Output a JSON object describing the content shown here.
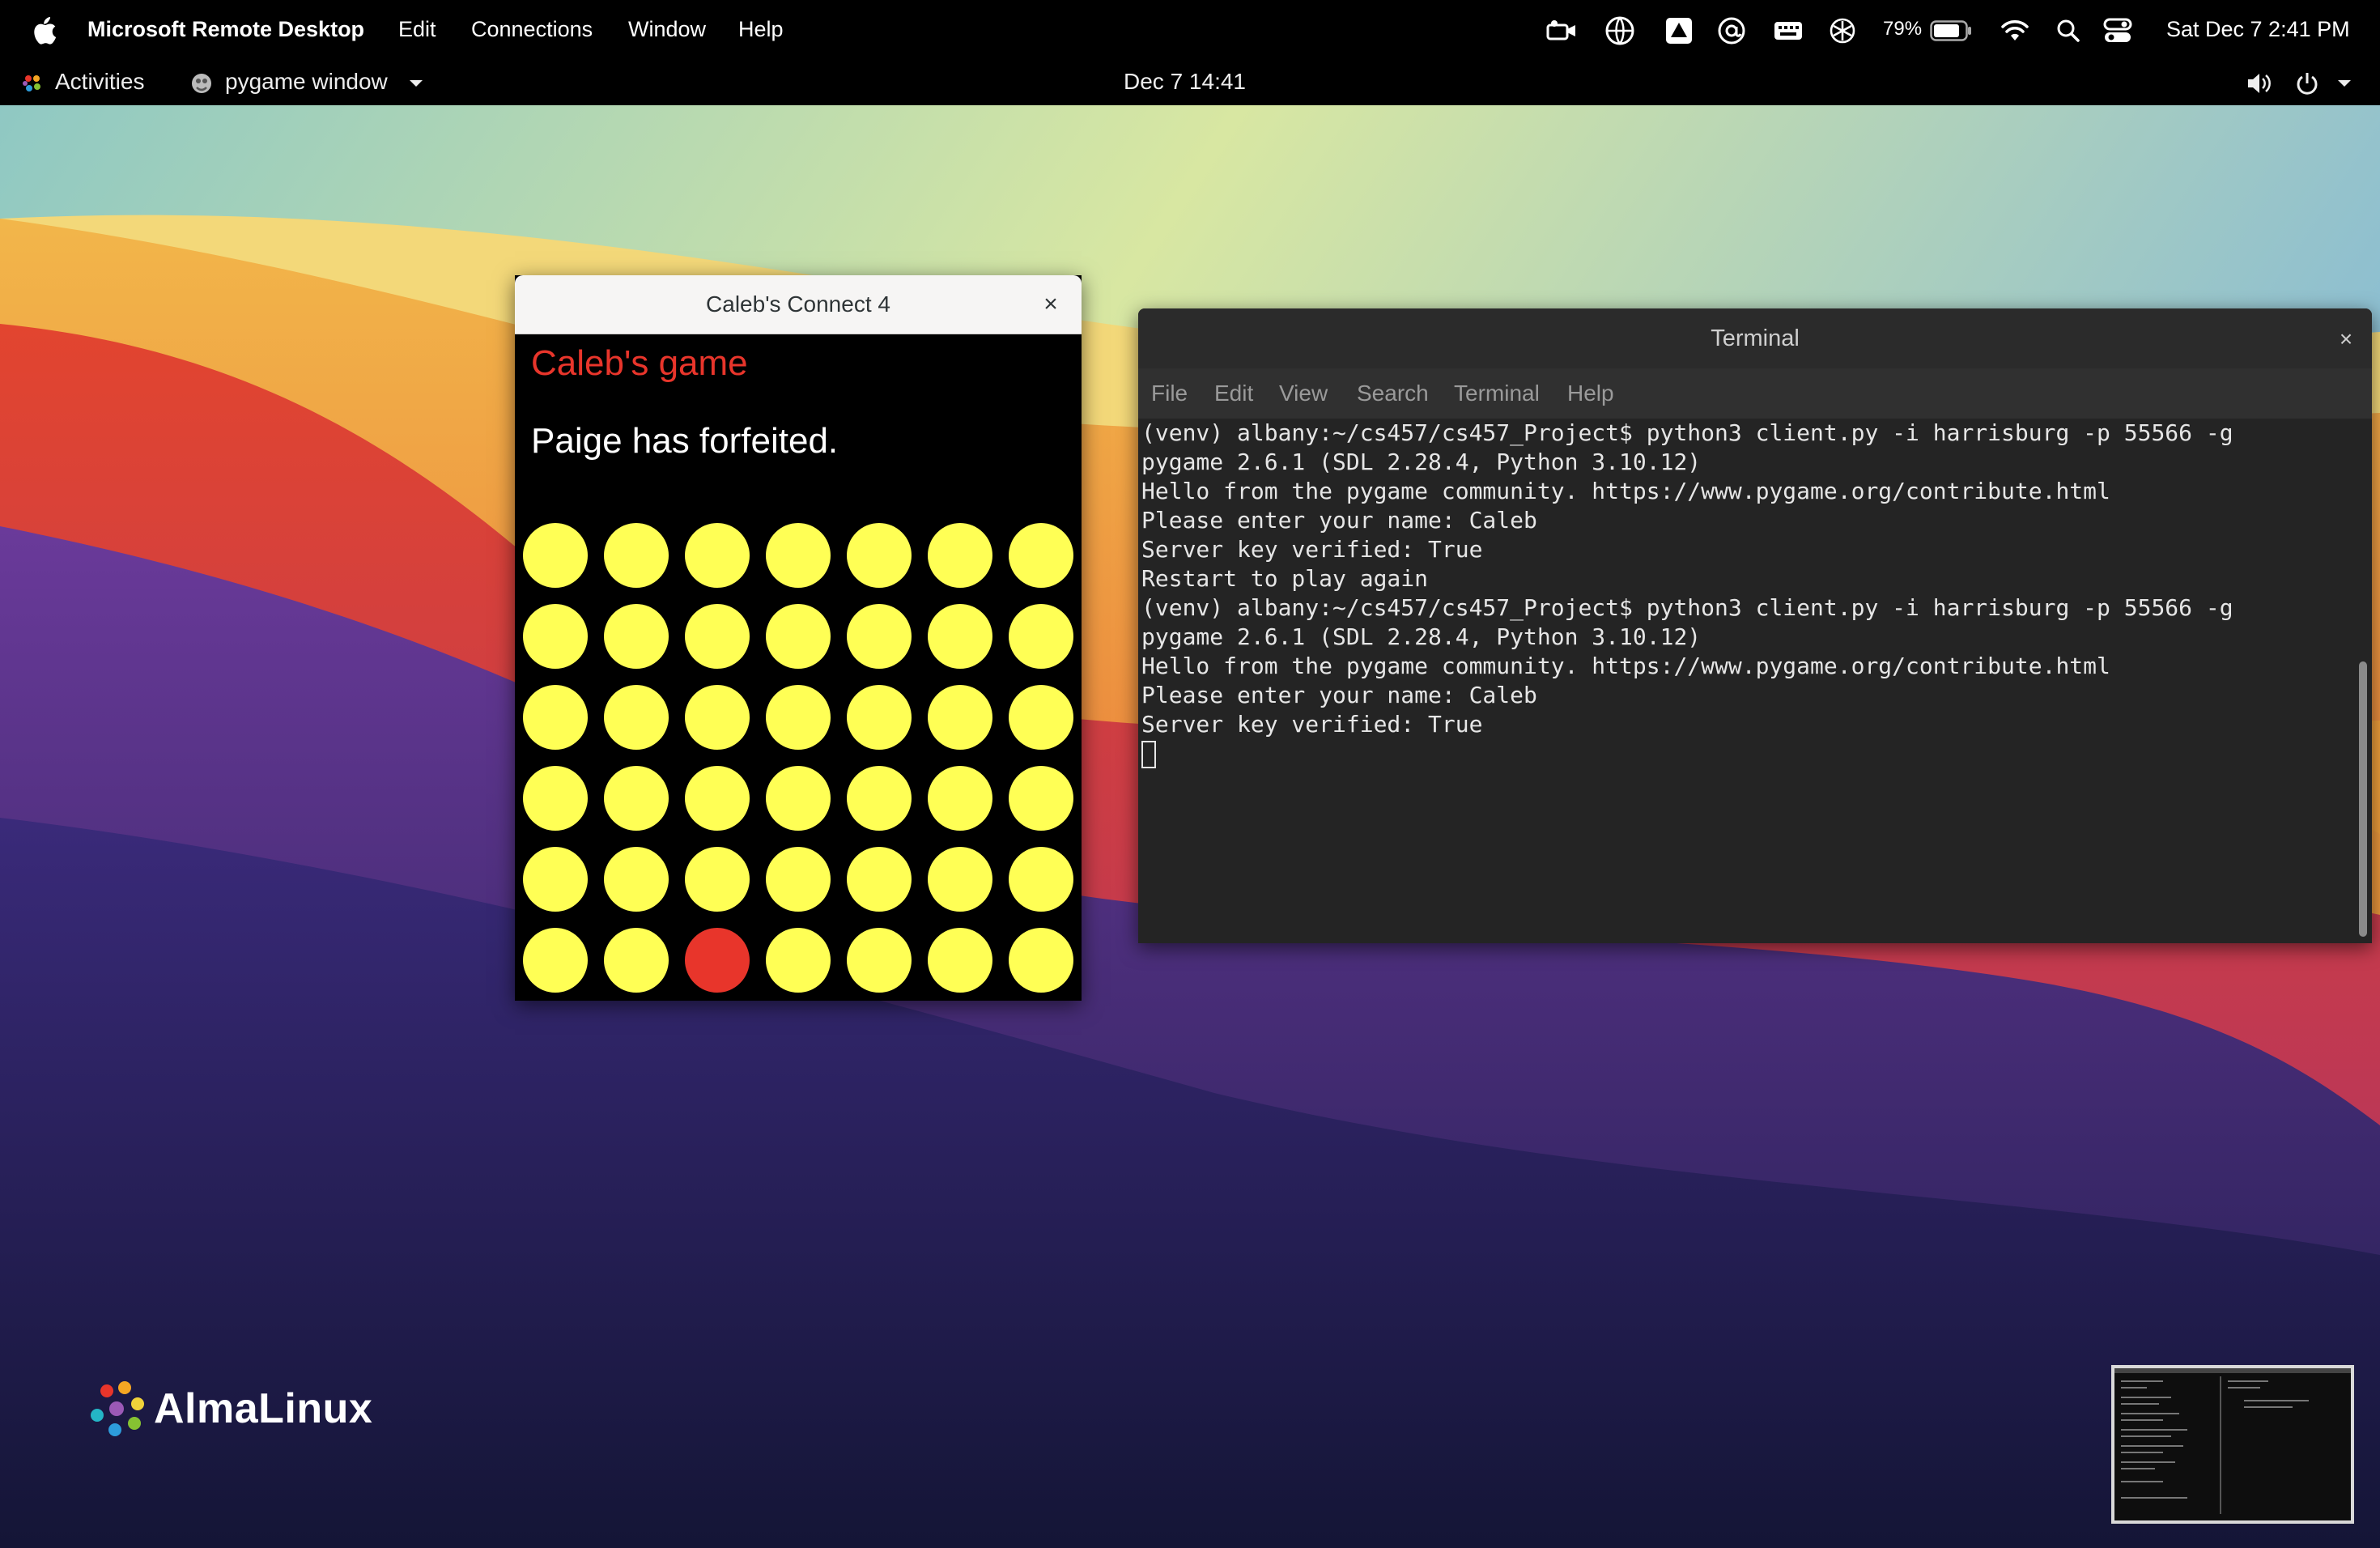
{
  "mac_menubar": {
    "app_name": "Microsoft Remote Desktop",
    "menus": [
      "Edit",
      "Connections",
      "Window",
      "Help"
    ],
    "battery_percent": "79%",
    "datetime": "Sat Dec 7  2:41 PM"
  },
  "gnome_topbar": {
    "activities": "Activities",
    "app_menu": "pygame window",
    "clock": "Dec 7  14:41"
  },
  "pygame_window": {
    "title": "Caleb's Connect 4",
    "close_glyph": "×",
    "game_title": "Caleb's game",
    "status": "Paige has forfeited.",
    "colors": {
      "empty": "#ffff55",
      "red": "#e8352b",
      "background": "#000000"
    },
    "board": [
      [
        "empty",
        "empty",
        "empty",
        "empty",
        "empty",
        "empty",
        "empty"
      ],
      [
        "empty",
        "empty",
        "empty",
        "empty",
        "empty",
        "empty",
        "empty"
      ],
      [
        "empty",
        "empty",
        "empty",
        "empty",
        "empty",
        "empty",
        "empty"
      ],
      [
        "empty",
        "empty",
        "empty",
        "empty",
        "empty",
        "empty",
        "empty"
      ],
      [
        "empty",
        "empty",
        "empty",
        "empty",
        "empty",
        "empty",
        "empty"
      ],
      [
        "empty",
        "empty",
        "red",
        "empty",
        "empty",
        "empty",
        "empty"
      ]
    ]
  },
  "terminal": {
    "title": "Terminal",
    "close_glyph": "×",
    "menus": [
      "File",
      "Edit",
      "View",
      "Search",
      "Terminal",
      "Help"
    ],
    "lines": [
      "(venv) albany:~/cs457/cs457_Project$ python3 client.py -i harrisburg -p 55566 -g",
      "pygame 2.6.1 (SDL 2.28.4, Python 3.10.12)",
      "Hello from the pygame community. https://www.pygame.org/contribute.html",
      "Please enter your name: Caleb",
      "Server key verified: True",
      "Restart to play again",
      "(venv) albany:~/cs457/cs457_Project$ python3 client.py -i harrisburg -p 55566 -g",
      "pygame 2.6.1 (SDL 2.28.4, Python 3.10.12)",
      "Hello from the pygame community. https://www.pygame.org/contribute.html",
      "Please enter your name: Caleb",
      "Server key verified: True"
    ]
  },
  "desktop": {
    "logo_text": "AlmaLinux"
  }
}
